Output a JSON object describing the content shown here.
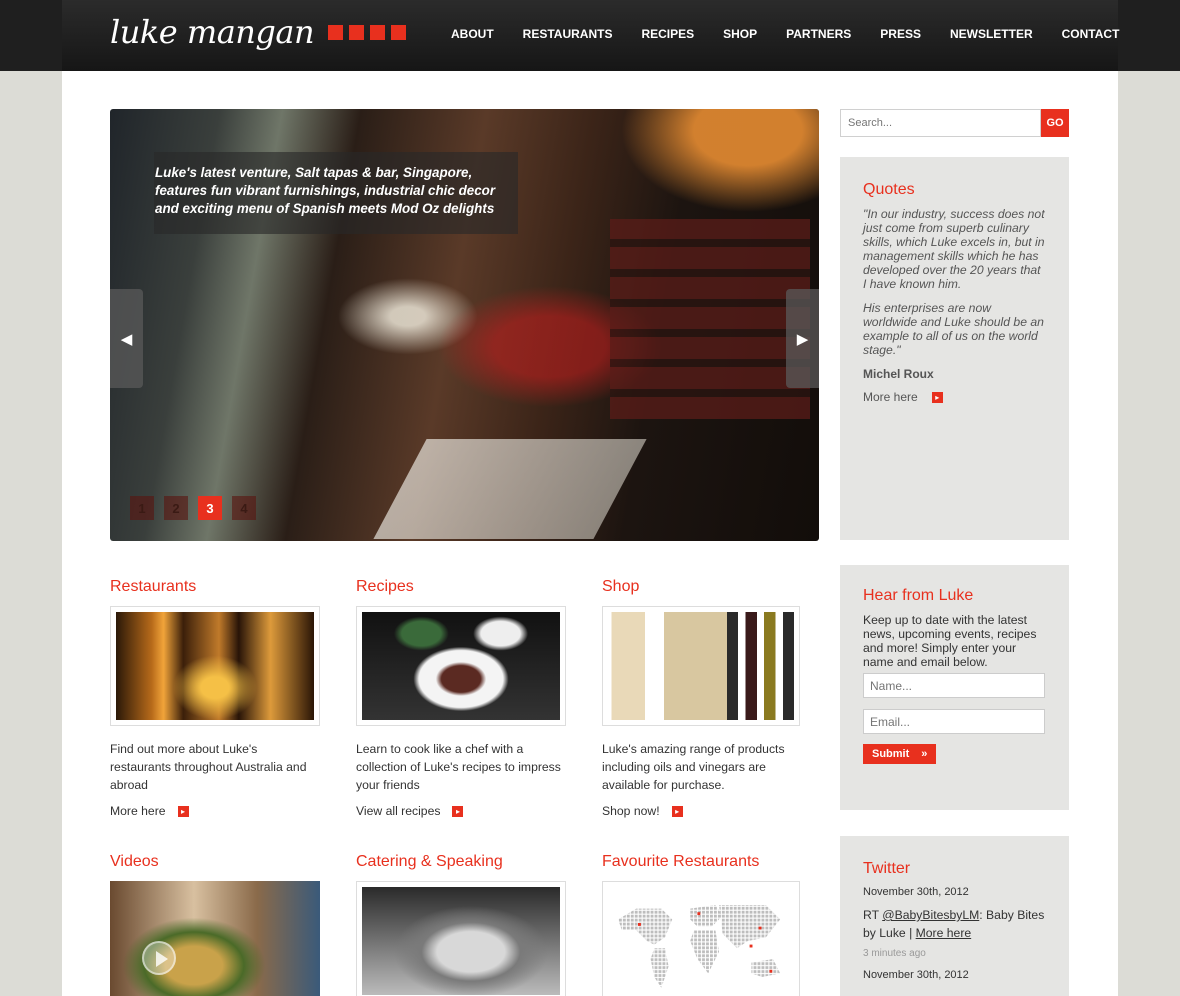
{
  "header": {
    "logo_text": "luke mangan",
    "nav": [
      {
        "label": "ABOUT"
      },
      {
        "label": "RESTAURANTS"
      },
      {
        "label": "RECIPES"
      },
      {
        "label": "SHOP"
      },
      {
        "label": "PARTNERS"
      },
      {
        "label": "PRESS"
      },
      {
        "label": "NEWSLETTER"
      },
      {
        "label": "CONTACT"
      }
    ]
  },
  "slider": {
    "caption": "Luke's latest venture, Salt tapas & bar, Singapore, features fun vibrant furnishings, industrial chic decor and exciting menu of Spanish meets Mod Oz delights",
    "pages": [
      "1",
      "2",
      "3",
      "4"
    ],
    "active_page": "3",
    "prev_icon": "◀",
    "next_icon": "▶"
  },
  "search": {
    "placeholder": "Search...",
    "button": "GO"
  },
  "quotes": {
    "title": "Quotes",
    "paragraph1": "\"In our industry, success does not just come from superb culinary skills, which Luke excels in, but in management skills which he has developed over the 20 years that I have known him.",
    "paragraph2": "His enterprises are now worldwide and Luke should be an example to all of us on the world stage.\"",
    "author": "Michel Roux",
    "more": "More here"
  },
  "newsletter": {
    "title": "Hear from Luke",
    "text": "Keep up to date with the latest news, upcoming events, recipes and more! Simply enter your name and email below.",
    "name_placeholder": "Name...",
    "email_placeholder": "Email...",
    "submit": "Submit"
  },
  "twitter": {
    "title": "Twitter",
    "tweets": [
      {
        "date": "November 30th, 2012",
        "prefix": "RT ",
        "handle": "@BabyBitesbyLM",
        "text": ": Baby Bites by Luke | ",
        "link": "More here",
        "ago": "3 minutes ago"
      },
      {
        "date": "November 30th, 2012"
      }
    ]
  },
  "columns": [
    {
      "title": "Restaurants",
      "text": "Find out more about Luke's restaurants throughout Australia and abroad",
      "more": "More here"
    },
    {
      "title": "Recipes",
      "text": "Learn to cook like a chef with a collection of Luke's recipes to impress your friends",
      "more": "View all recipes"
    },
    {
      "title": "Shop",
      "text": "Luke's amazing range of products including oils and vinegars are available for purchase.",
      "more": "Shop now!"
    },
    {
      "title": "Videos"
    },
    {
      "title": "Catering & Speaking"
    },
    {
      "title": "Favourite Restaurants"
    }
  ],
  "colors": {
    "accent": "#e8301e",
    "header_bg": "#1f1f1f",
    "sidebar_box": "#e5e5e3"
  },
  "icons": {
    "arrow_small": "▸",
    "submit_arrows": "»"
  }
}
